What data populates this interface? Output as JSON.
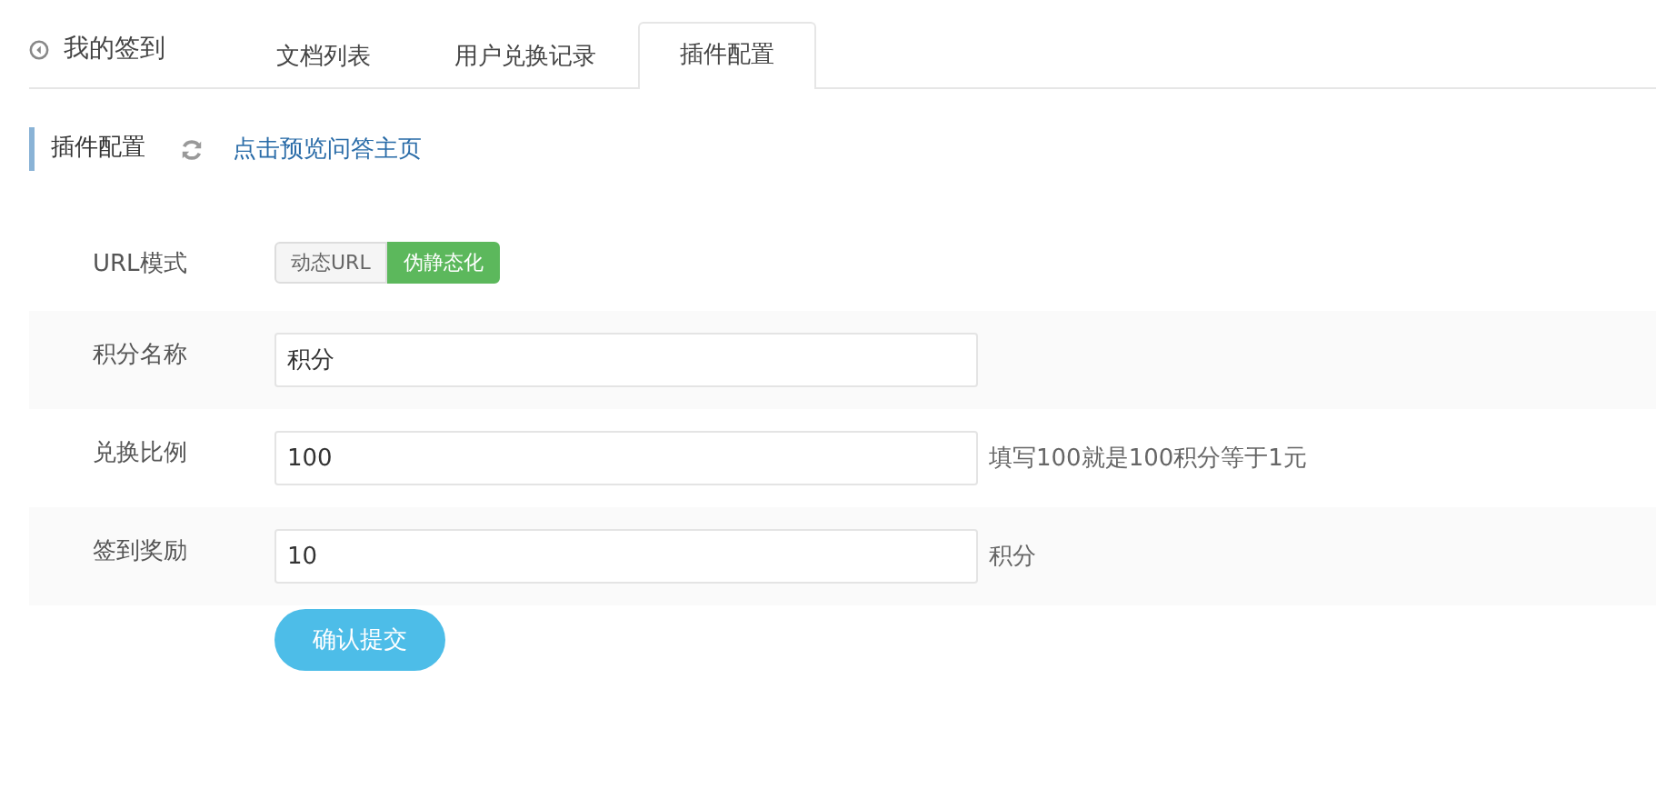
{
  "page_title": "我的签到",
  "tabs": [
    {
      "label": "文档列表",
      "selected": false
    },
    {
      "label": "用户兑换记录",
      "selected": false
    },
    {
      "label": "插件配置",
      "selected": true
    }
  ],
  "section": {
    "title": "插件配置",
    "link": "点击预览问答主页"
  },
  "fields": [
    {
      "kind": "toggle",
      "label": "URL模式",
      "options": [
        {
          "label": "动态URL",
          "selected": false
        },
        {
          "label": "伪静态化",
          "selected": true
        }
      ]
    },
    {
      "kind": "text",
      "label": "积分名称",
      "value": "积分"
    },
    {
      "kind": "text",
      "label": "兑换比例",
      "value": "100",
      "hint": "填写100就是100积分等于1元"
    },
    {
      "kind": "text",
      "label": "签到奖励",
      "value": "10",
      "hint": "积分"
    }
  ],
  "submit": "确认提交"
}
